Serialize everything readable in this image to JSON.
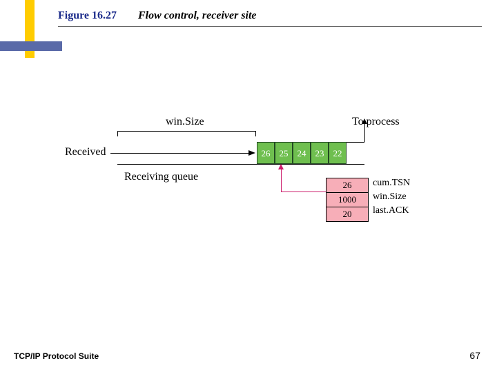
{
  "header": {
    "figure_number": "Figure 16.27",
    "figure_title": "Flow control, receiver site"
  },
  "diagram": {
    "received_label": "Received",
    "winsize_label": "win.Size",
    "receiving_queue_label": "Receiving queue",
    "to_process_label": "To process",
    "queue": [
      "26",
      "25",
      "24",
      "23",
      "22"
    ],
    "state_table": [
      {
        "value": "26",
        "label": "cum.TSN"
      },
      {
        "value": "1000",
        "label": "win.Size"
      },
      {
        "value": "20",
        "label": "last.ACK"
      }
    ],
    "colors": {
      "queue_cell": "#6fbf4f",
      "state_cell": "#f7aeb8",
      "pointer": "#cc1a6a",
      "accent_bar_v": "#ffcc00",
      "accent_bar_h": "#5a6aa8"
    }
  },
  "footer": {
    "text": "TCP/IP Protocol Suite",
    "page": "67"
  }
}
